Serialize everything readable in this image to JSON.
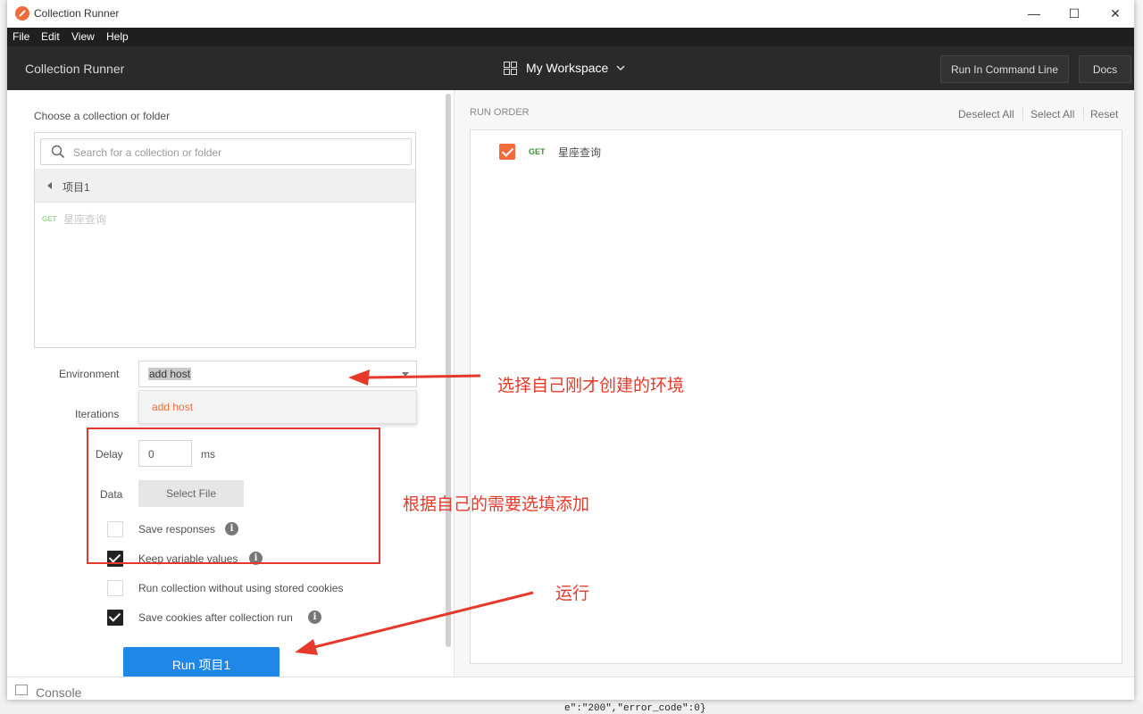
{
  "window": {
    "title": "Collection Runner",
    "controls": [
      "—",
      "☐",
      "✕"
    ]
  },
  "menu": [
    "File",
    "Edit",
    "View",
    "Help"
  ],
  "toolbar": {
    "title": "Collection Runner",
    "workspace": "My Workspace",
    "run_cli": "Run In Command Line",
    "docs": "Docs"
  },
  "left": {
    "choose_label": "Choose a collection or folder",
    "search_placeholder": "Search for a collection or folder",
    "breadcrumb": "项目1",
    "request": {
      "method": "GET",
      "name": "星座查询"
    },
    "environment_label": "Environment",
    "environment_value": "add host",
    "environment_option": "add host",
    "iterations_label": "Iterations",
    "delay_label": "Delay",
    "delay_value": "0",
    "delay_unit": "ms",
    "data_label": "Data",
    "select_file": "Select File",
    "opt_save_responses": "Save responses",
    "opt_keep_vars": "Keep variable values",
    "opt_no_cookies": "Run collection without using stored cookies",
    "opt_save_cookies": "Save cookies after collection run",
    "run_button": "Run 项目1"
  },
  "right": {
    "run_order": "RUN ORDER",
    "deselect_all": "Deselect All",
    "select_all": "Select All",
    "reset": "Reset",
    "item": {
      "method": "GET",
      "name": "星座查询"
    }
  },
  "statusbar": {
    "console": "Console"
  },
  "annotations": {
    "env": "选择自己刚才创建的环境",
    "options": "根据自己的需要选填添加",
    "run": "运行"
  },
  "background": {
    "code": "e\":\"200\",\"error_code\":0}"
  },
  "colors": {
    "accent": "#f26b3a",
    "run_button": "#1f87e8",
    "annotation": "#e53a2b",
    "toolbar": "#2a2a2a"
  }
}
